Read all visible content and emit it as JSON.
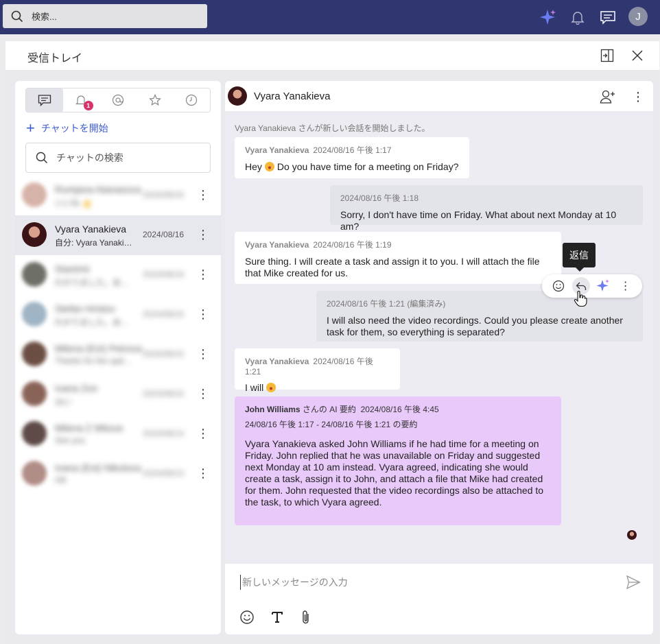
{
  "topbar": {
    "search_placeholder": "検索...",
    "user_initial": "J",
    "icons": [
      "search-icon",
      "sparkle-icon",
      "bell-icon",
      "chat-icon"
    ]
  },
  "window": {
    "title": "受信トレイ"
  },
  "left": {
    "tabs": [
      {
        "name": "chats",
        "icon": "chat-icon"
      },
      {
        "name": "notifications",
        "icon": "bell-icon",
        "badge": "1"
      },
      {
        "name": "mentions",
        "icon": "at-icon"
      },
      {
        "name": "favorites",
        "icon": "star-icon"
      },
      {
        "name": "recent",
        "icon": "clock-icon"
      }
    ],
    "start_chat_label": "チャットを開始",
    "search_placeholder": "チャットの検索",
    "chats": [
      {
        "name": "Rumjana Atanasova",
        "preview": "いいね 👍",
        "date": "2024/08/16",
        "blurred": true
      },
      {
        "name": "Vyara Yanakieva",
        "preview": "自分: Vyara Yanakieva asked",
        "date": "2024/08/16",
        "blurred": false
      },
      {
        "name": "Stanimir",
        "preview": "わかりました。ありがとう",
        "date": "2024/08/16",
        "blurred": true
      },
      {
        "name": "Stefan Hristov",
        "preview": "わかりました。ありがとう",
        "date": "2024/08/16",
        "blurred": true
      },
      {
        "name": "Milena (Ext) Petrova",
        "preview": "Thanks for the update",
        "date": "2024/08/15",
        "blurred": true
      },
      {
        "name": "Ivana Zon",
        "preview": "はい",
        "date": "2024/08/15",
        "blurred": true
      },
      {
        "name": "Milena Z Mitova",
        "preview": "See you",
        "date": "2024/08/14",
        "blurred": true
      },
      {
        "name": "Ivana (Ext) Nikolova",
        "preview": "OK",
        "date": "2024/08/13",
        "blurred": true
      }
    ]
  },
  "conversation": {
    "name": "Vyara Yanakieva",
    "system_message": "Vyara Yanakieva さんが新しい会話を開始しました。",
    "messages": [
      {
        "sender": "Vyara Yanakieva",
        "time": "2024/08/16 午後 1:17",
        "text_a": "Hey",
        "text_b": "Do you have time for a meeting on Friday?"
      },
      {
        "sender": "",
        "time": "2024/08/16 午後 1:18",
        "text": "Sorry, I don't have time on Friday. What about next Monday at 10 am?"
      },
      {
        "sender": "Vyara Yanakieva",
        "time": "2024/08/16 午後 1:19",
        "text": "Sure thing. I will create a task and assign it to you. I will attach the file that Mike created for us."
      },
      {
        "sender": "",
        "time": "2024/08/16 午後 1:21 (編集済み)",
        "text": "I will also need the video recordings. Could you please create another task for them, so everything is separated?"
      },
      {
        "sender": "Vyara Yanakieva",
        "time": "2024/08/16 午後 1:21",
        "text": "I will"
      }
    ],
    "summary": {
      "author": "John Williams",
      "author_suffix": "さんの AI 要約",
      "time": "2024/08/16 午後 4:45",
      "range": "24/08/16 午後 1:17 - 24/08/16 午後 1:21 の要約",
      "text": "Vyara Yanakieva asked John Williams if he had time for a meeting on Friday. John replied that he was unavailable on Friday and suggested next Monday at 10 am instead. Vyara agreed, indicating she would create a task, assign it to John, and attach a file that Mike had created for them. John requested that the video recordings also be attached to the task, to which Vyara agreed."
    },
    "tooltip": "返信",
    "composer_placeholder": "新しいメッセージの入力"
  }
}
